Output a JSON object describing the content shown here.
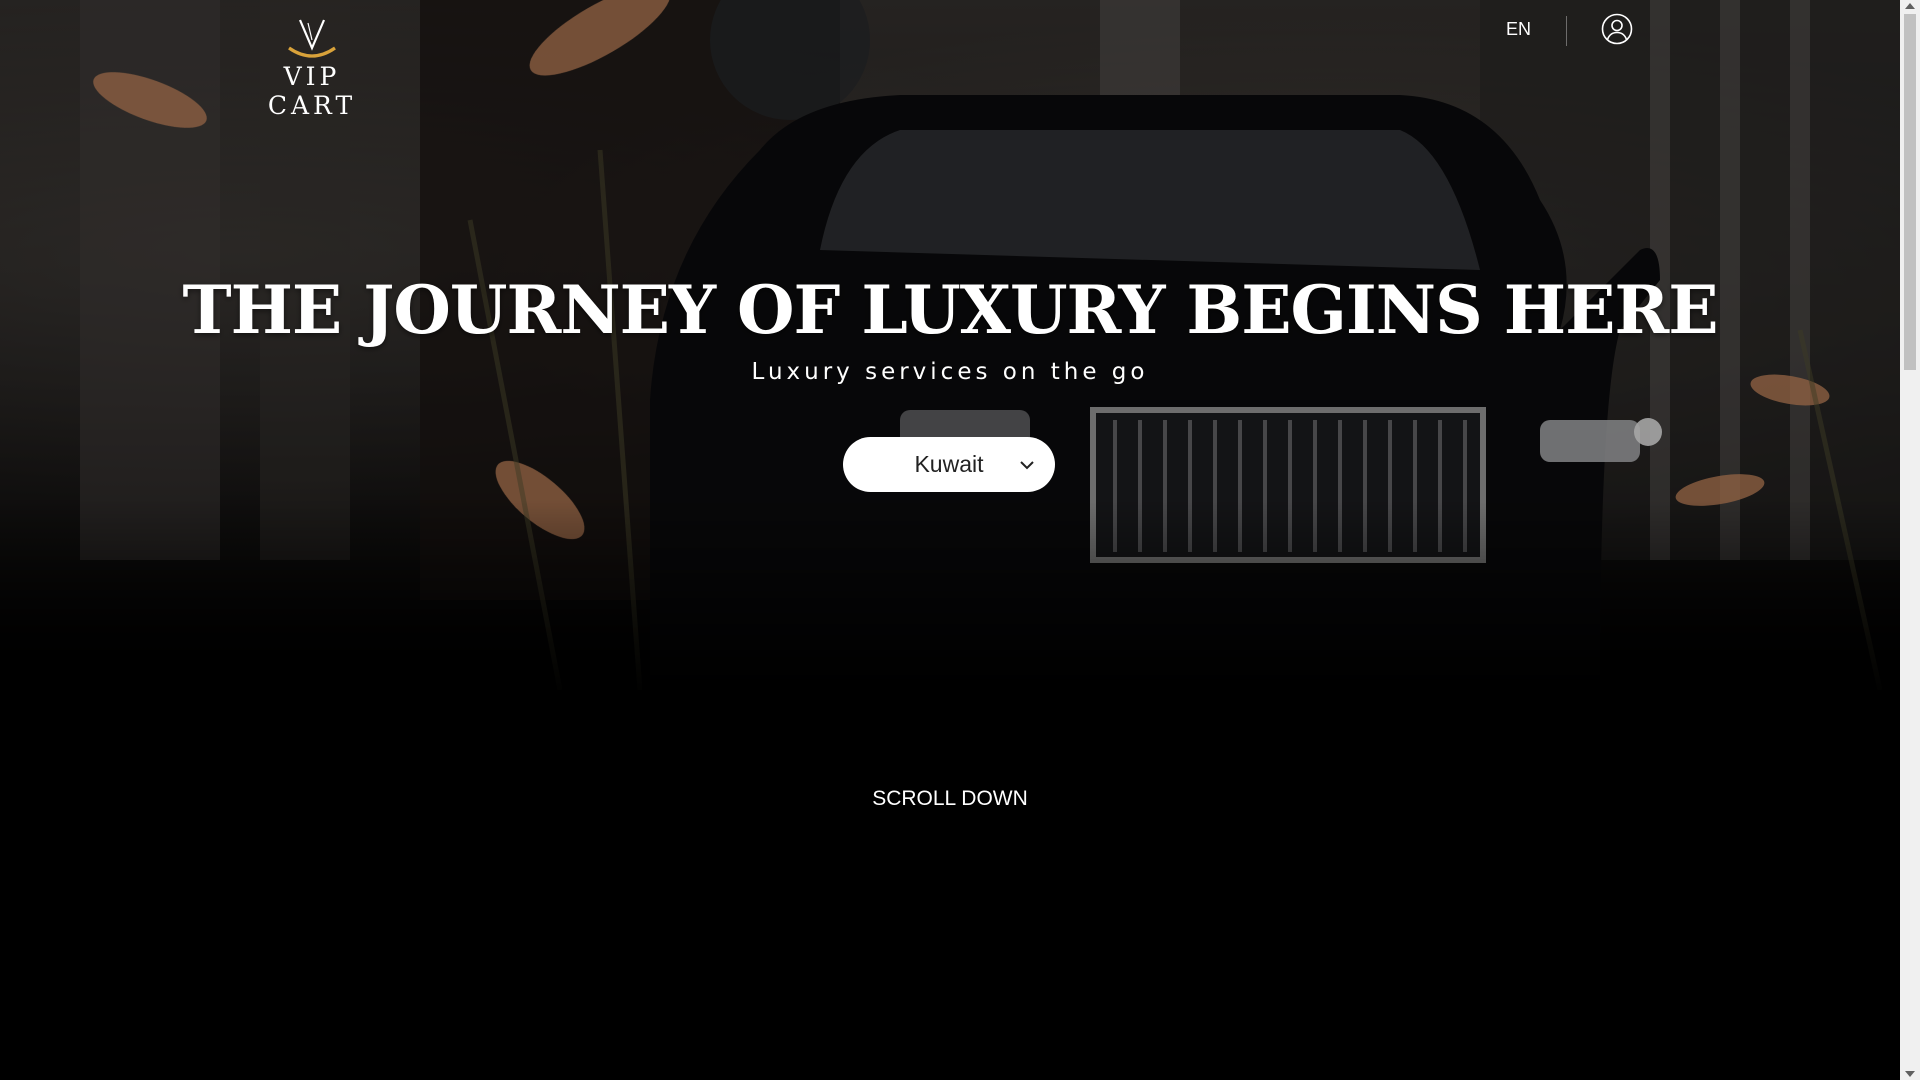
{
  "header": {
    "logo_text": "VIP CART",
    "language": "EN",
    "account_icon": "user-circle-icon"
  },
  "hero": {
    "headline": "THE JOURNEY OF LUXURY BEGINS HERE",
    "subline": "Luxury services on the go",
    "country_select": {
      "selected": "Kuwait",
      "icon": "chevron-down-icon"
    },
    "scroll_label": "SCROLL DOWN"
  },
  "colors": {
    "background": "#000000",
    "logo_accent": "#d9a23a",
    "text": "#ffffff",
    "select_bg": "#ffffff"
  }
}
